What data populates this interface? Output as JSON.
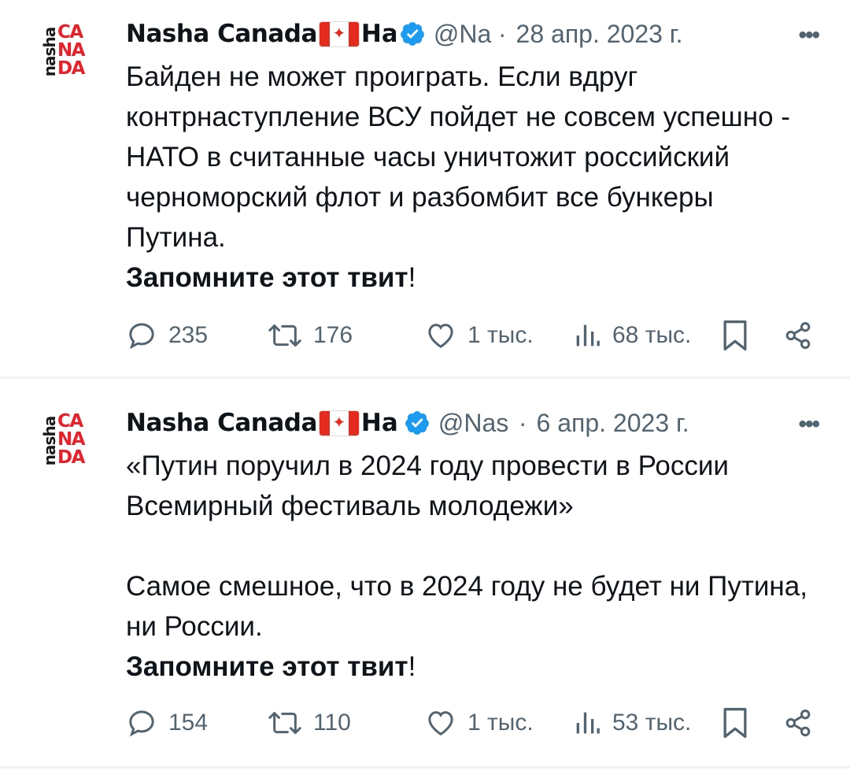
{
  "tweets": [
    {
      "avatar": {
        "side_text": "nasha",
        "main_lines": [
          "CA",
          "NA",
          "DA"
        ]
      },
      "author": {
        "name": "Nasha Canada",
        "name_tail": "На",
        "flag": "canada-flag",
        "verified": true
      },
      "handle": "@Nas",
      "separator": "·",
      "date": "28 апр. 2023 г.",
      "more": "•••",
      "text": "Байден не может проиграть. Если вдруг контрнаступление ВСУ пойдет не совсем успешно - НАТО в считанные часы уничтожит российский черноморский флот и разбомбит все бункеры Путина.",
      "emphasis": "Запомните этот твит",
      "emphasis_tail": "!",
      "stats": {
        "replies": "235",
        "retweets": "176",
        "likes": "1 тыс.",
        "views": "68 тыс."
      }
    },
    {
      "avatar": {
        "side_text": "nasha",
        "main_lines": [
          "CA",
          "NA",
          "DA"
        ]
      },
      "author": {
        "name": "Nasha Canada",
        "name_tail": "На",
        "flag": "canada-flag",
        "verified": true
      },
      "handle": "@Nas",
      "separator": "·",
      "date": "6 апр. 2023 г.",
      "more": "•••",
      "text": "«Путин поручил в 2024 году провести в России Всемирный фестиваль молодежи»\n\nСамое смешное, что в 2024 году не будет ни Путина, ни России.",
      "emphasis": "Запомните этот твит",
      "emphasis_tail": "!",
      "stats": {
        "replies": "154",
        "retweets": "110",
        "likes": "1 тыс.",
        "views": "53 тыс."
      }
    }
  ],
  "colors": {
    "text": "#0f1419",
    "secondary": "#536471",
    "verified": "#1d9bf0",
    "logo_red": "#e8202a",
    "divider": "#eff3f4"
  }
}
